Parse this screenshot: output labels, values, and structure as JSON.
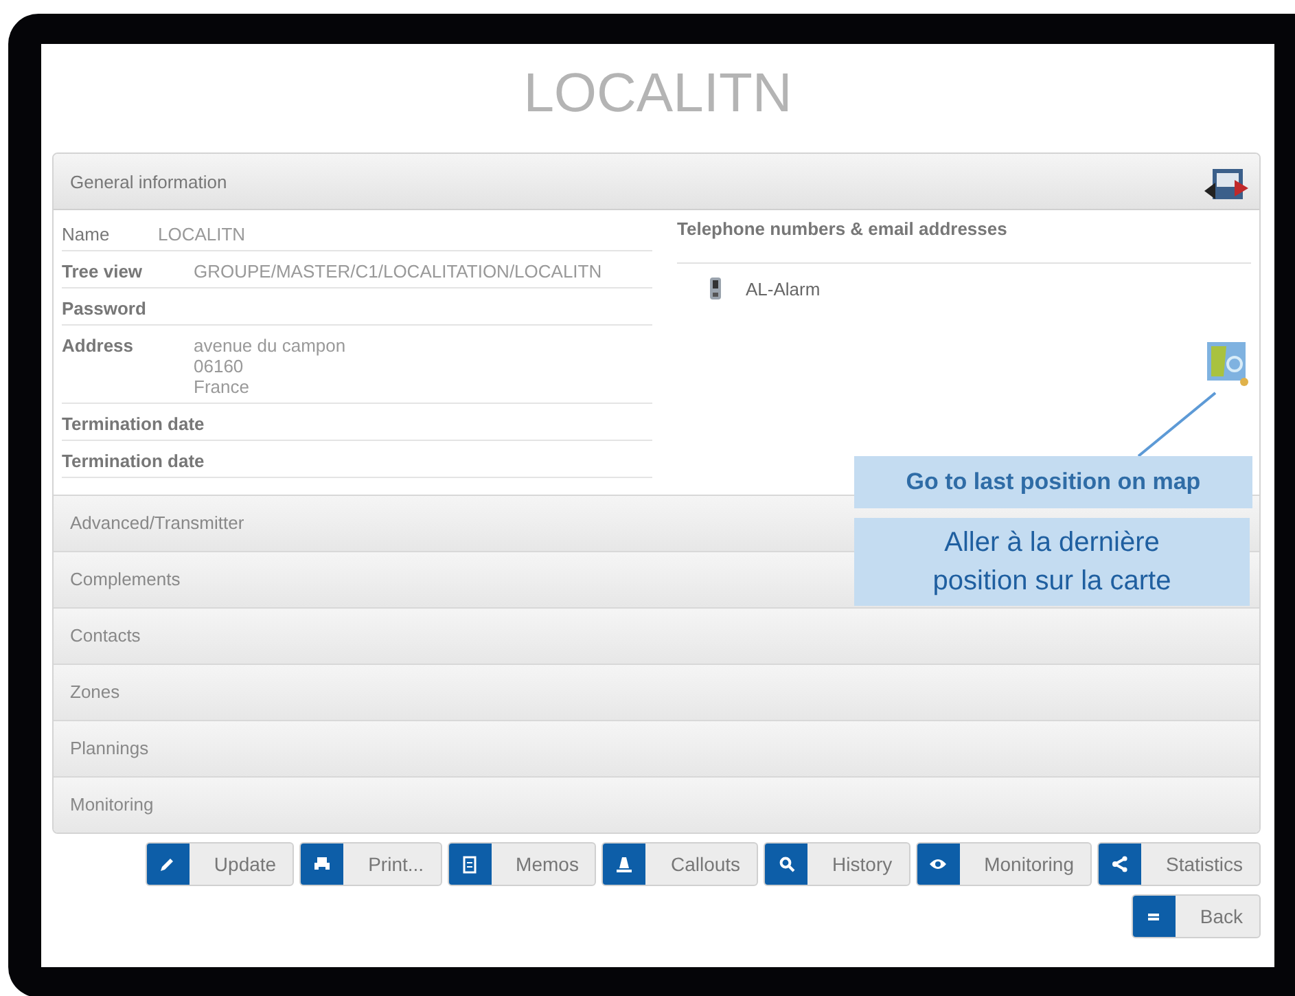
{
  "title": "LOCALITN",
  "general": {
    "header": "General information",
    "fields": [
      {
        "label": "Name",
        "value": [
          "LOCALITN"
        ]
      },
      {
        "label": "Tree view",
        "value": [
          "GROUPE/MASTER/C1/LOCALITATION/LOCALITN"
        ]
      },
      {
        "label": "Password"
      },
      {
        "label": "Address",
        "value": [
          "avenue du campon",
          "06160",
          "France"
        ]
      },
      {
        "label": "Termination date"
      },
      {
        "label": "Termination date"
      }
    ],
    "contacts_title": "Telephone numbers & email addresses",
    "contacts": [
      "AL-Alarm"
    ]
  },
  "sections": [
    "Advanced/Transmitter",
    "Complements",
    "Contacts",
    "Zones",
    "Plannings",
    "Monitoring"
  ],
  "callouts": [
    "Go to last position on map",
    "Aller à la dernière position sur la carte"
  ],
  "buttons": [
    {
      "label": "Update",
      "kind": "pencil"
    },
    {
      "label": "Print...",
      "kind": "printer"
    },
    {
      "label": "Memos",
      "kind": "note"
    },
    {
      "label": "Callouts",
      "kind": "cone"
    },
    {
      "label": "History",
      "kind": "search"
    },
    {
      "label": "Monitoring",
      "kind": "eye"
    },
    {
      "label": "Statistics",
      "kind": "share"
    }
  ],
  "back": {
    "label": "Back",
    "kind": "back"
  }
}
